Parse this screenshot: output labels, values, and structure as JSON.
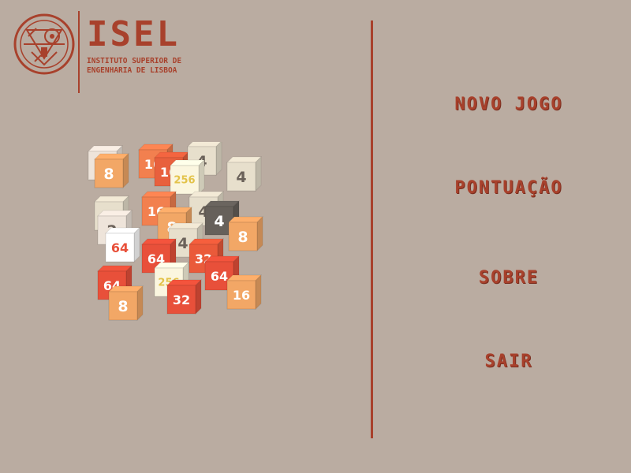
{
  "logo": {
    "name": "ISEL",
    "subtitle": "INSTITUTO SUPERIOR DE\nENGENHARIA DE LISBOA",
    "color": "#a8412c"
  },
  "menu": {
    "items": [
      {
        "label": "NOVO JOGO"
      },
      {
        "label": "PONTUAÇÃO"
      },
      {
        "label": "SOBRE"
      },
      {
        "label": "SAIR"
      }
    ]
  },
  "cube_art": {
    "tiles": [
      {
        "value": "2",
        "color": "#eee4da"
      },
      {
        "value": "8",
        "color": "#f2a766"
      },
      {
        "value": "16",
        "color": "#f2804f"
      },
      {
        "value": "16",
        "color": "#e8603d"
      },
      {
        "value": "4",
        "color": "#e7dfcc"
      },
      {
        "value": "4",
        "color": "#e7dfcc"
      },
      {
        "value": "256",
        "color": "#fbf6df"
      },
      {
        "value": "4",
        "color": "#e7dfcc"
      },
      {
        "value": "16",
        "color": "#f2804f"
      },
      {
        "value": "4",
        "color": "#e7dfcc"
      },
      {
        "value": "4",
        "color": "#66605a"
      },
      {
        "value": "2",
        "color": "#eee4da"
      },
      {
        "value": "8",
        "color": "#f2a766"
      },
      {
        "value": "8",
        "color": "#f2a766"
      },
      {
        "value": "4",
        "color": "#e7dfcc"
      },
      {
        "value": "64",
        "color": "#ffffff"
      },
      {
        "value": "64",
        "color": "#e8503a"
      },
      {
        "value": "32",
        "color": "#ea5a3a"
      },
      {
        "value": "64",
        "color": "#e8503a"
      },
      {
        "value": "64",
        "color": "#e8503a"
      },
      {
        "value": "256",
        "color": "#fbf6df"
      },
      {
        "value": "16",
        "color": "#f2a766"
      },
      {
        "value": "8",
        "color": "#f2a766"
      },
      {
        "value": "32",
        "color": "#e8503a"
      }
    ]
  }
}
